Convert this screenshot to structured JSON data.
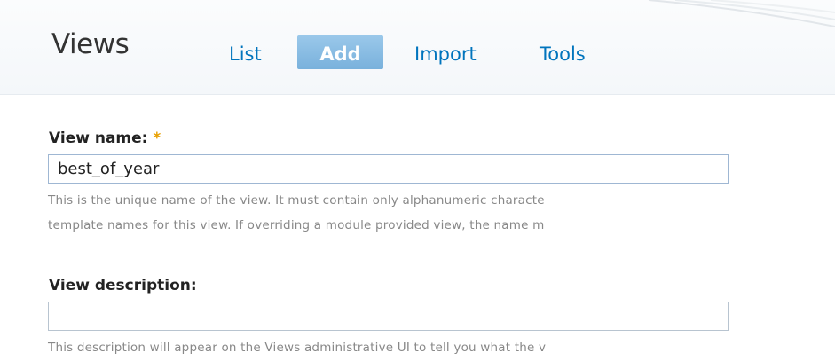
{
  "header": {
    "title": "Views",
    "tabs": [
      {
        "label": "List",
        "active": false
      },
      {
        "label": "Add",
        "active": true
      },
      {
        "label": "Import",
        "active": false
      },
      {
        "label": "Tools",
        "active": false
      }
    ]
  },
  "form": {
    "view_name": {
      "label": "View name:",
      "required_marker": "*",
      "value": "best_of_year",
      "help_line_1": "This is the unique name of the view. It must contain only alphanumeric characte",
      "help_line_2": "template names for this view. If overriding a module provided view, the name m"
    },
    "view_description": {
      "label": "View description:",
      "value": "",
      "help_line_1": "This description will appear on the Views administrative UI to tell you what the v"
    }
  },
  "colors": {
    "tab_link": "#0074bd",
    "tab_active_bg": "#8cbde4",
    "required": "#e8a000",
    "help_text": "#888888"
  }
}
